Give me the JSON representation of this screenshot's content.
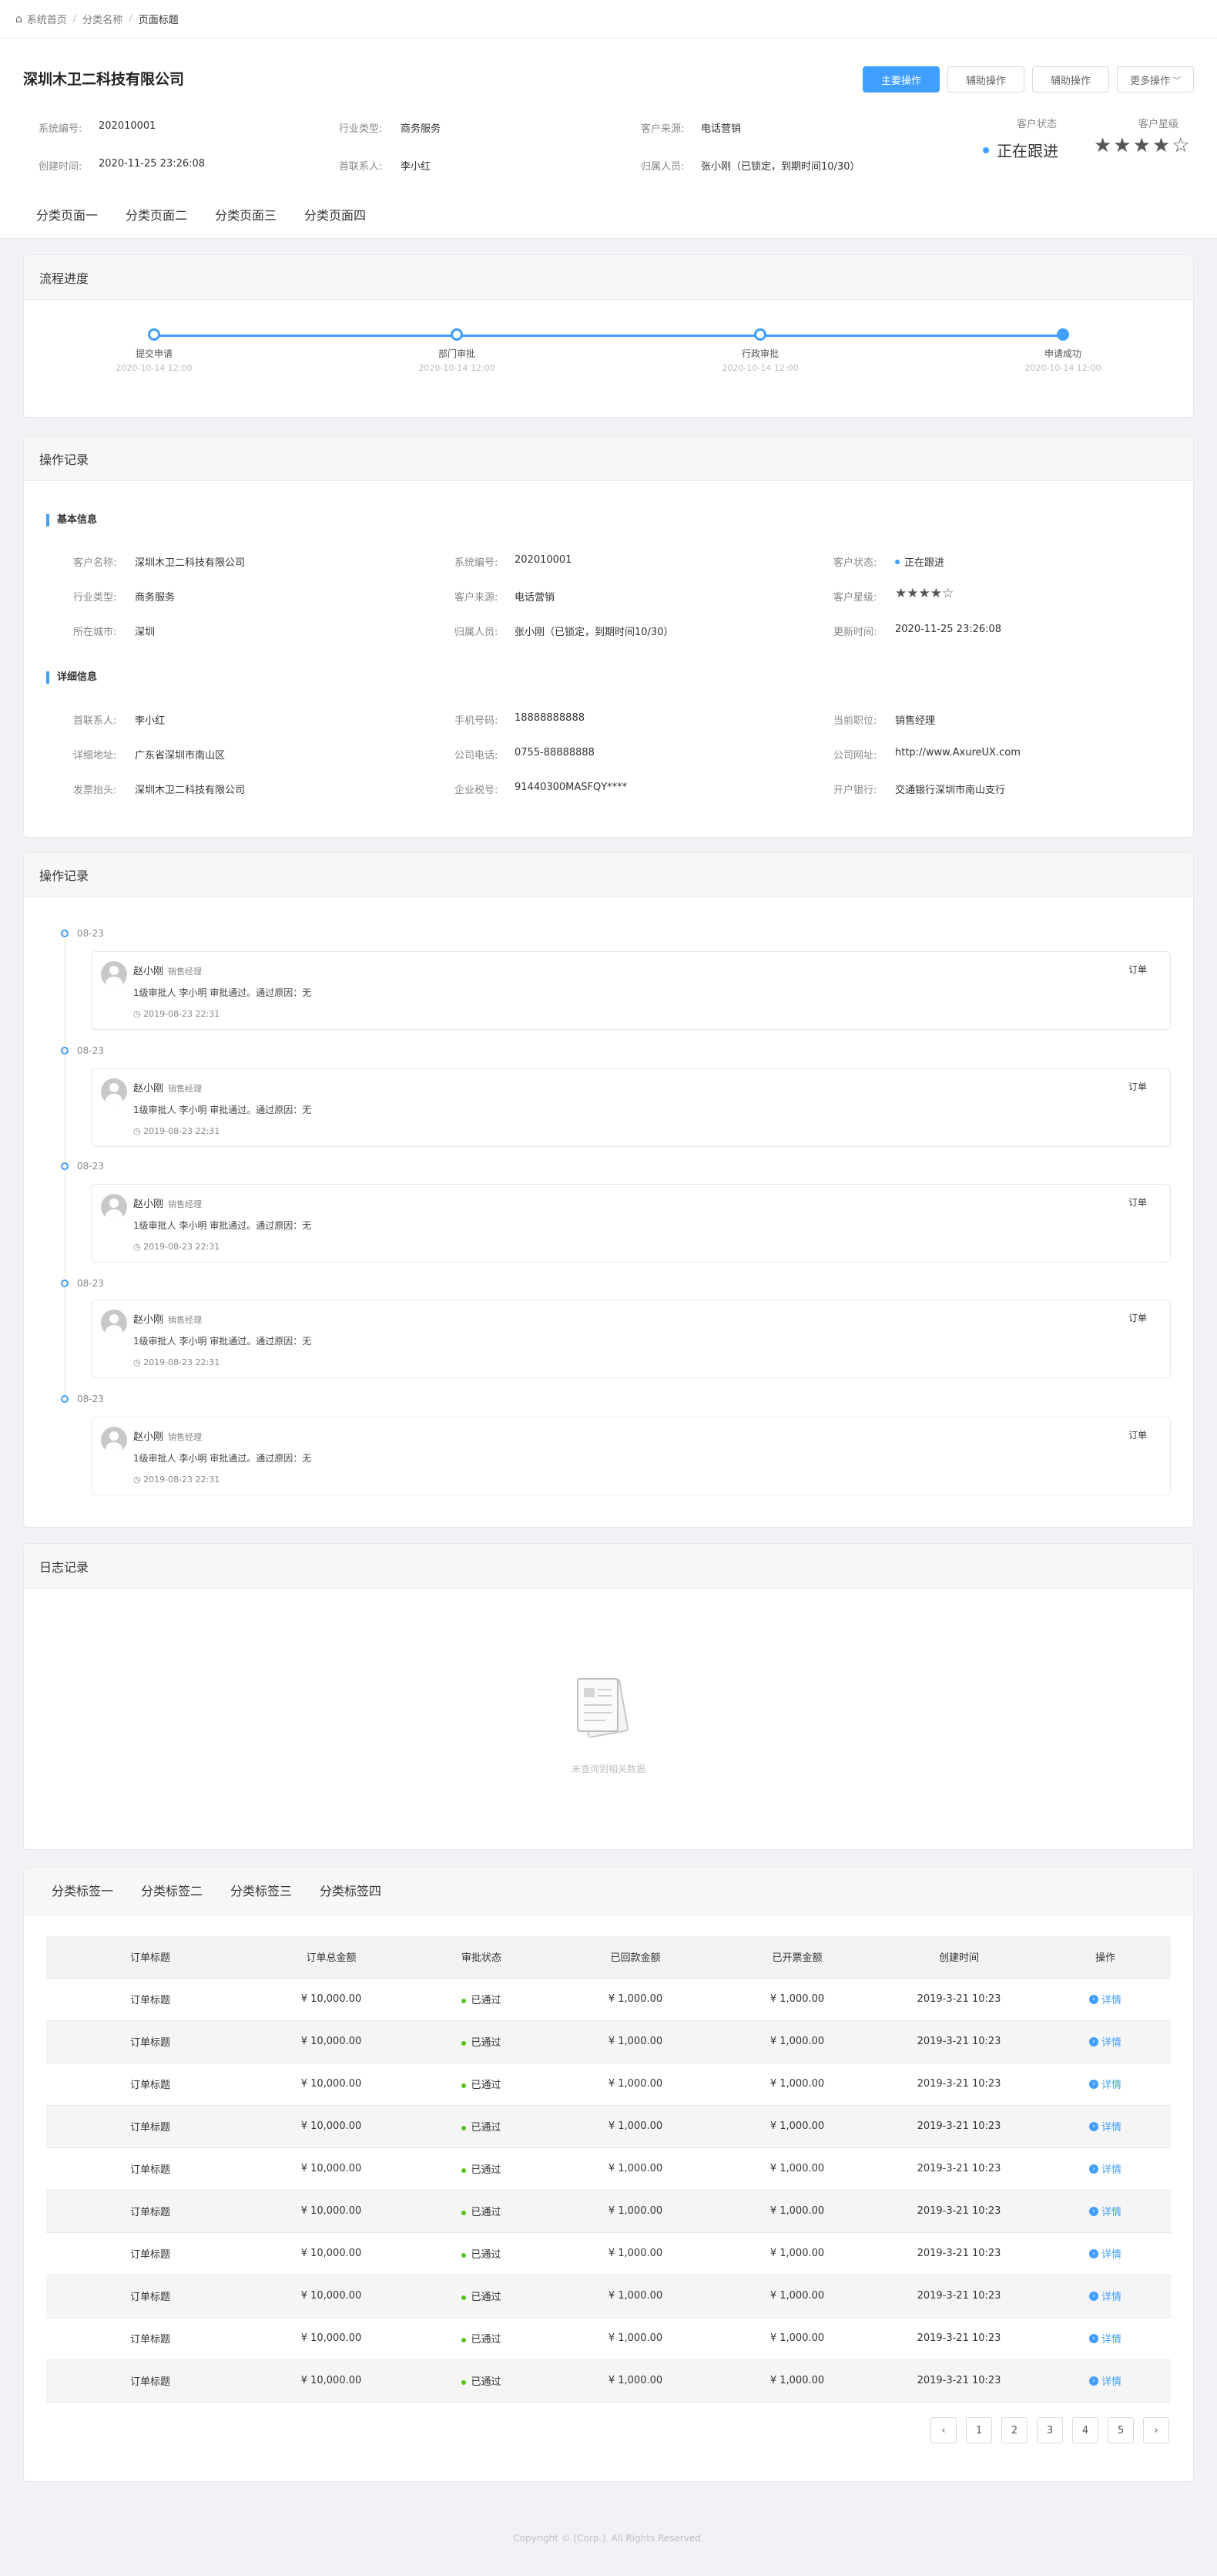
{
  "breadcrumb": {
    "home": "系统首页",
    "category": "分类名称",
    "current": "页面标题"
  },
  "header": {
    "company": "深圳木卫二科技有限公司",
    "buttons": {
      "primary": "主要操作",
      "aux1": "辅助操作",
      "aux2": "辅助操作",
      "more": "更多操作"
    },
    "fields": {
      "sys_no_label": "系统编号:",
      "sys_no": "202010001",
      "industry_label": "行业类型:",
      "industry": "商务服务",
      "source_label": "客户来源:",
      "source": "电话营销",
      "created_label": "创建时间:",
      "created": "2020-11-25 23:26:08",
      "contact_label": "首联系人:",
      "contact": "李小红",
      "owner_label": "归属人员:",
      "owner": "张小刚（已锁定，到期时间10/30）"
    },
    "status_label": "客户状态",
    "status": "正在跟进",
    "level_label": "客户星级",
    "stars": "★★★★☆",
    "tabs": [
      "分类页面一",
      "分类页面二",
      "分类页面三",
      "分类页面四"
    ]
  },
  "progress": {
    "title": "流程进度",
    "steps": [
      {
        "name": "提交申请",
        "time": "2020-10-14 12:00"
      },
      {
        "name": "部门审批",
        "time": "2020-10-14 12:00"
      },
      {
        "name": "行政审批",
        "time": "2020-10-14 12:00"
      },
      {
        "name": "申请成功",
        "time": "2020-10-14 12:00"
      }
    ]
  },
  "info": {
    "title": "操作记录",
    "basic_title": "基本信息",
    "detail_title": "详细信息",
    "basic": [
      {
        "l": "客户名称:",
        "v": "深圳木卫二科技有限公司"
      },
      {
        "l": "系统编号:",
        "v": "202010001"
      },
      {
        "l": "客户状态:",
        "v": "正在跟进"
      },
      {
        "l": "行业类型:",
        "v": "商务服务"
      },
      {
        "l": "客户来源:",
        "v": "电话营销"
      },
      {
        "l": "客户星级:",
        "v": "★★★★☆"
      },
      {
        "l": "所在城市:",
        "v": "深圳"
      },
      {
        "l": "归属人员:",
        "v": "张小刚（已锁定，到期时间10/30）"
      },
      {
        "l": "更新时间:",
        "v": "2020-11-25 23:26:08"
      }
    ],
    "detail": [
      {
        "l": "首联系人:",
        "v": "李小红"
      },
      {
        "l": "手机号码:",
        "v": "18888888888"
      },
      {
        "l": "当前职位:",
        "v": "销售经理"
      },
      {
        "l": "详细地址:",
        "v": "广东省深圳市南山区"
      },
      {
        "l": "公司电话:",
        "v": "0755-88888888"
      },
      {
        "l": "公司网址:",
        "v": "http://www.AxureUX.com"
      },
      {
        "l": "发票抬头:",
        "v": "深圳木卫二科技有限公司"
      },
      {
        "l": "企业税号:",
        "v": "91440300MASFQY****"
      },
      {
        "l": "开户银行:",
        "v": "交通银行深圳市南山支行"
      }
    ]
  },
  "timeline": {
    "title": "操作记录",
    "items": [
      {
        "date": "08-23",
        "name": "赵小刚",
        "role": "销售经理",
        "text": "1级审批人 李小明 审批通过。通过原因：无",
        "time": "2019-08-23 22:31",
        "tag": "订单"
      },
      {
        "date": "08-23",
        "name": "赵小刚",
        "role": "销售经理",
        "text": "1级审批人 李小明 审批通过。通过原因：无",
        "time": "2019-08-23 22:31",
        "tag": "订单"
      },
      {
        "date": "08-23",
        "name": "赵小刚",
        "role": "销售经理",
        "text": "1级审批人 李小明 审批通过。通过原因：无",
        "time": "2019-08-23 22:31",
        "tag": "订单"
      },
      {
        "date": "08-23",
        "name": "赵小刚",
        "role": "销售经理",
        "text": "1级审批人 李小明 审批通过。通过原因：无",
        "time": "2019-08-23 22:31",
        "tag": "订单"
      },
      {
        "date": "08-23",
        "name": "赵小刚",
        "role": "销售经理",
        "text": "1级审批人 李小明 审批通过。通过原因：无",
        "time": "2019-08-23 22:31",
        "tag": "订单"
      }
    ]
  },
  "log": {
    "title": "日志记录",
    "empty": "未查询到相关数据"
  },
  "orders": {
    "tabs": [
      "分类标签一",
      "分类标签二",
      "分类标签三",
      "分类标签四"
    ],
    "columns": [
      "订单标题",
      "订单总金额",
      "审批状态",
      "已回款金额",
      "已开票金额",
      "创建时间",
      "操作"
    ],
    "rows": [
      [
        "订单标题",
        "¥ 10,000.00",
        "已通过",
        "¥ 1,000.00",
        "¥ 1,000.00",
        "2019-3-21 10:23",
        "详情"
      ],
      [
        "订单标题",
        "¥ 10,000.00",
        "已通过",
        "¥ 1,000.00",
        "¥ 1,000.00",
        "2019-3-21 10:23",
        "详情"
      ],
      [
        "订单标题",
        "¥ 10,000.00",
        "已通过",
        "¥ 1,000.00",
        "¥ 1,000.00",
        "2019-3-21 10:23",
        "详情"
      ],
      [
        "订单标题",
        "¥ 10,000.00",
        "已通过",
        "¥ 1,000.00",
        "¥ 1,000.00",
        "2019-3-21 10:23",
        "详情"
      ],
      [
        "订单标题",
        "¥ 10,000.00",
        "已通过",
        "¥ 1,000.00",
        "¥ 1,000.00",
        "2019-3-21 10:23",
        "详情"
      ],
      [
        "订单标题",
        "¥ 10,000.00",
        "已通过",
        "¥ 1,000.00",
        "¥ 1,000.00",
        "2019-3-21 10:23",
        "详情"
      ],
      [
        "订单标题",
        "¥ 10,000.00",
        "已通过",
        "¥ 1,000.00",
        "¥ 1,000.00",
        "2019-3-21 10:23",
        "详情"
      ],
      [
        "订单标题",
        "¥ 10,000.00",
        "已通过",
        "¥ 1,000.00",
        "¥ 1,000.00",
        "2019-3-21 10:23",
        "详情"
      ],
      [
        "订单标题",
        "¥ 10,000.00",
        "已通过",
        "¥ 1,000.00",
        "¥ 1,000.00",
        "2019-3-21 10:23",
        "详情"
      ],
      [
        "订单标题",
        "¥ 10,000.00",
        "已通过",
        "¥ 1,000.00",
        "¥ 1,000.00",
        "2019-3-21 10:23",
        "详情"
      ]
    ],
    "pager": {
      "prev": "‹",
      "pages": [
        "1",
        "2",
        "3",
        "4",
        "5"
      ],
      "next": "›"
    }
  },
  "footer": "Copyright © [Corp.]. All Rights Reserved.",
  "colors": {
    "accent": "#409eff",
    "success": "#52c41a"
  }
}
